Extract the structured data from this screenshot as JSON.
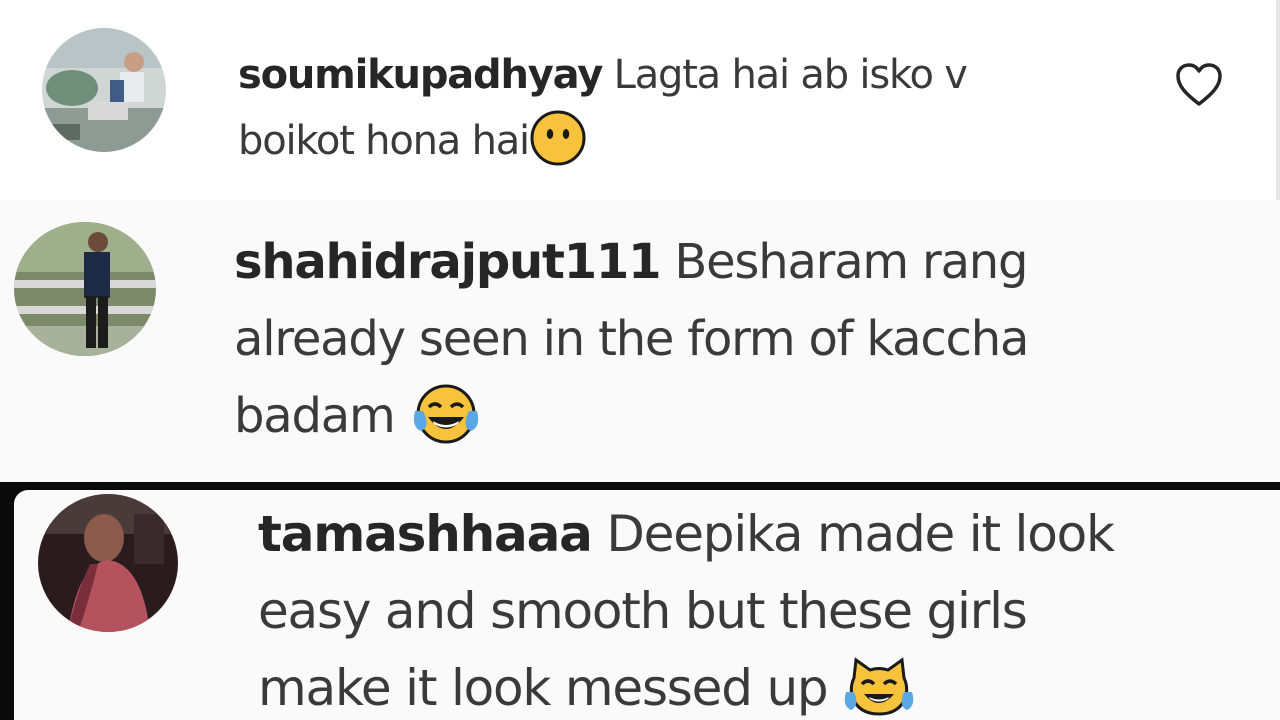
{
  "comments": [
    {
      "username": "soumikupadhyay",
      "line1": " Lagta hai ab isko v",
      "line2": "boikot hona hai",
      "emoji": "face-without-mouth-emoji",
      "liked": false
    },
    {
      "username": "shahidrajput111",
      "line1": " Besharam rang",
      "line2": "already seen in the form of kaccha",
      "line3": "badam ",
      "emoji": "face-with-tears-of-joy-emoji"
    },
    {
      "username": "tamashhaaa",
      "line1": " Deepika made it look",
      "line2": "easy and smooth but these girls",
      "line3": "make it look messed up ",
      "emoji": "cat-with-tears-of-joy-emoji"
    }
  ],
  "colors": {
    "text": "#262626",
    "emoji_yellow": "#f7c23c",
    "emoji_tears": "#5aa9e6"
  },
  "icons": {
    "like": "heart-outline-icon"
  }
}
